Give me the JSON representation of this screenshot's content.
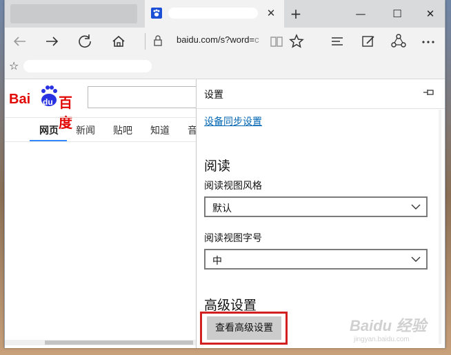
{
  "browser": {
    "url_text": "baidu.com/s?word=",
    "url_faded": "c",
    "icons": [
      "back-icon",
      "forward-icon",
      "refresh-icon",
      "home-icon",
      "lock-icon",
      "reading-view-icon",
      "favorite-star-icon",
      "hub-icon",
      "web-note-icon",
      "share-icon",
      "more-icon"
    ],
    "window_controls": {
      "minimize": "—",
      "maximize": "☐",
      "close": "✕"
    },
    "new_tab": "+",
    "tab_close": "✕"
  },
  "baidu": {
    "logo_left": "Bai",
    "logo_du": "du",
    "logo_right": "百度",
    "nav_tabs": [
      "网页",
      "新闻",
      "贴吧",
      "知道",
      "音"
    ]
  },
  "settings": {
    "title": "设置",
    "sync_link": "设备同步设置",
    "reading_heading": "阅读",
    "reading_style_label": "阅读视图风格",
    "reading_style_value": "默认",
    "reading_font_label": "阅读视图字号",
    "reading_font_value": "中",
    "advanced_heading": "高级设置",
    "advanced_button": "查看高级设置"
  },
  "watermark": {
    "main": "Baidu 经验",
    "sub": "jingyan.baidu.com"
  },
  "colors": {
    "accent_link": "#0065b3",
    "highlight_box": "#d21f1f",
    "baidu_red": "#e10602",
    "baidu_blue": "#2932e1"
  }
}
